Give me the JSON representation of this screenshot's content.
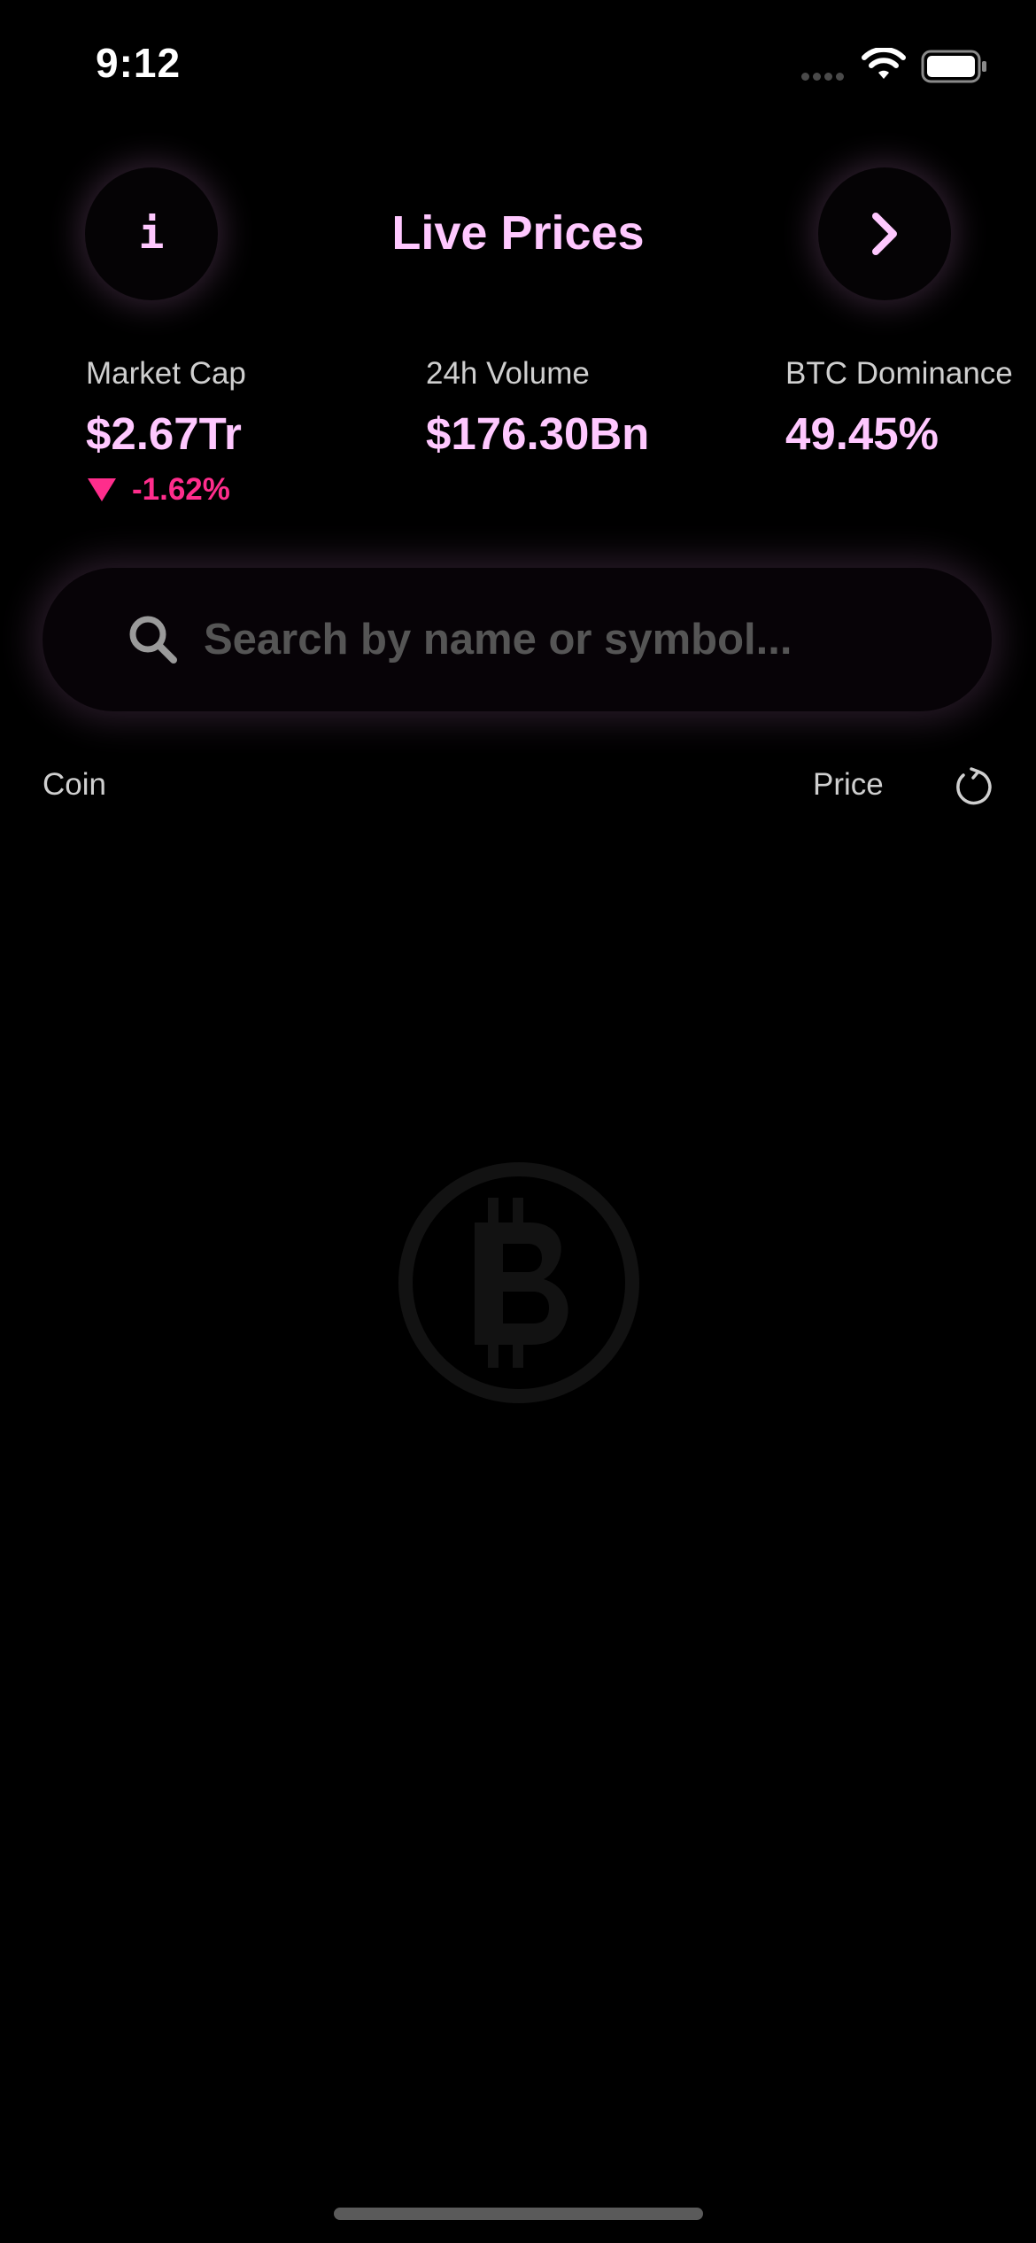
{
  "status_bar": {
    "time": "9:12",
    "icons": [
      "cellular-signal-icon",
      "wifi-icon",
      "battery-icon"
    ]
  },
  "header": {
    "title": "Live Prices",
    "left_button_icon": "info-icon",
    "left_button_glyph": "i",
    "right_button_icon": "chevron-right-icon"
  },
  "stats": {
    "market_cap": {
      "label": "Market Cap",
      "value": "$2.67Tr",
      "change": "-1.62%",
      "direction": "down"
    },
    "volume": {
      "label": "24h Volume",
      "value": "$176.30Bn"
    },
    "btc_dominance": {
      "label": "BTC Dominance",
      "value": "49.45%"
    }
  },
  "search": {
    "placeholder": "Search by name or symbol...",
    "value": "",
    "icon": "search-icon"
  },
  "list_header": {
    "coin": "Coin",
    "price": "Price",
    "refresh_icon": "refresh-icon"
  },
  "empty_state": {
    "icon": "bitcoin-icon"
  },
  "colors": {
    "background": "#000000",
    "accent": "#ffc8ff",
    "negative": "#ff2d8c",
    "label": "#cfcfcf",
    "placeholder": "#555555"
  }
}
